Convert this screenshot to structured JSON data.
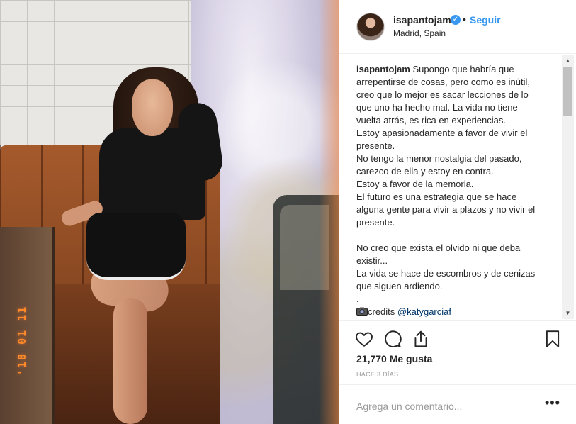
{
  "post": {
    "username": "isapantojam",
    "follow_label": "Seguir",
    "separator": "•",
    "location": "Madrid, Spain",
    "photo_timestamp": "'18 01 11",
    "caption_username": "isapantojam",
    "caption_text": " Supongo que habría que arrepentirse de cosas, pero como es inútil, creo que lo mejor es sacar lecciones de lo que uno ha hecho mal. La vida no tiene vuelta atrás, es rica en experiencias.\nEstoy apasionadamente a favor de vivir el presente.\nNo tengo la menor nostalgia del pasado, carezco de ella y estoy en contra.\nEstoy a favor de la memoria.\nEl futuro es una estrategia que se hace alguna gente para vivir a plazos y no vivir el presente.\n\nNo creo que exista el olvido ni que deba existir...\nLa vida se hace de escombros y de cenizas que siguen ardiendo.\n.",
    "credits_label": "credits",
    "credits_handle": "@katygarciaf",
    "likes": "21,770 Me gusta",
    "time_ago": "HACE 3 DÍAS",
    "comment_placeholder": "Agrega un comentario...",
    "more_label": "•••"
  },
  "icons": {
    "verified": "verified-badge-icon",
    "like": "heart-icon",
    "comment": "comment-bubble-icon",
    "share": "share-upload-icon",
    "save": "bookmark-icon",
    "scroll_up": "▲",
    "scroll_down": "▼",
    "camera": "camera-emoji-icon",
    "verified_glyph": "✓"
  },
  "colors": {
    "link_blue": "#3897f0",
    "text": "#262626",
    "muted": "#999999",
    "timestamp_orange": "#ff8a2a"
  }
}
